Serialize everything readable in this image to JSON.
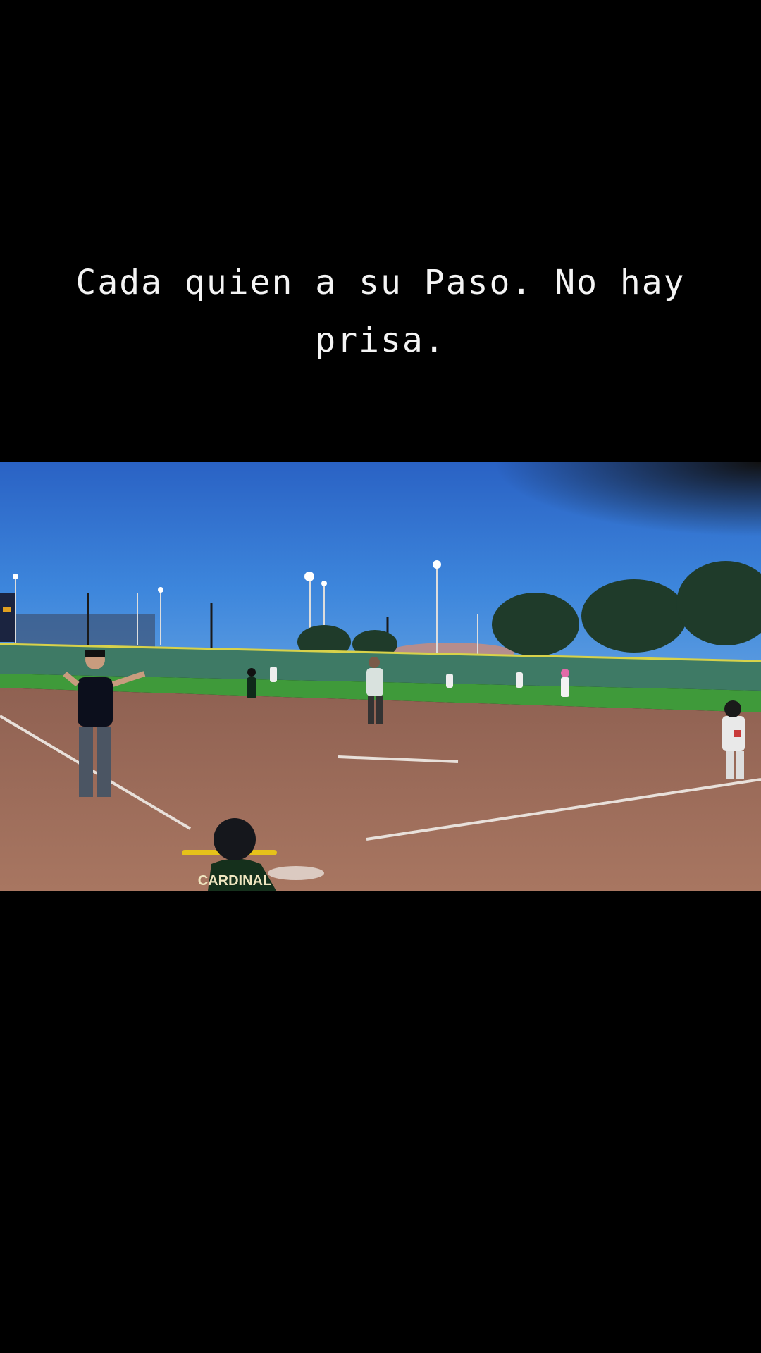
{
  "caption": {
    "text": "Cada quien a su Paso. No hay prisa."
  },
  "photo": {
    "subject": "youth-baseball-game-at-dusk",
    "jersey_text": "CARDINAL",
    "colors": {
      "sky_top": "#2f6fd0",
      "sky_bottom": "#4d97e6",
      "grass": "#3f9a3a",
      "dirt": "#9c6a55",
      "fence": "#3e7a65"
    }
  }
}
